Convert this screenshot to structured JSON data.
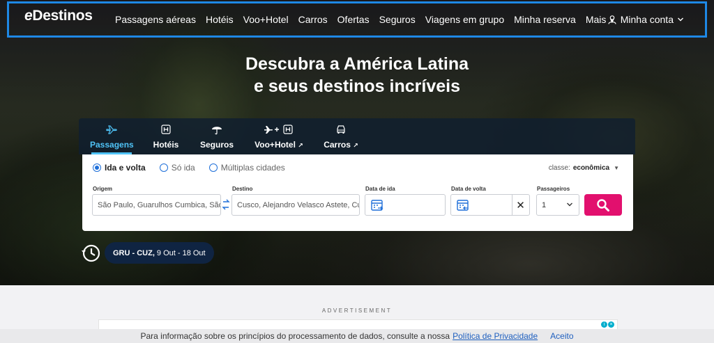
{
  "brand": {
    "logo_e": "e",
    "logo_rest": "Destinos"
  },
  "nav": {
    "items": [
      "Passagens aéreas",
      "Hotéis",
      "Voo+Hotel",
      "Carros",
      "Ofertas",
      "Seguros",
      "Viagens em grupo",
      "Minha reserva"
    ],
    "more_label": "Mais",
    "account_label": "Minha conta"
  },
  "hero": {
    "line1": "Descubra a América Latina",
    "line2": "e seus destinos incríveis"
  },
  "search_tabs": [
    {
      "label": "Passagens",
      "icon": "plane-icon",
      "active": true
    },
    {
      "label": "Hotéis",
      "icon": "hotel-icon",
      "active": false
    },
    {
      "label": "Seguros",
      "icon": "umbrella-icon",
      "active": false
    },
    {
      "label": "Voo+Hotel",
      "icon": "plane-plus-hotel-icon",
      "active": false,
      "external": true
    },
    {
      "label": "Carros",
      "icon": "car-icon",
      "active": false,
      "external": true
    }
  ],
  "trip_types": {
    "round_trip": "Ida e volta",
    "one_way": "Só ida",
    "multi_city": "Múltiplas cidades",
    "selected": "round_trip"
  },
  "classe": {
    "label": "classe:",
    "value": "econômica"
  },
  "fields": {
    "origin_label": "Origem",
    "origin_value": "São Paulo, Guarulhos Cumbica, São Paulo",
    "destination_label": "Destino",
    "destination_value": "Cusco, Alejandro Velasco Astete, Cusco",
    "depart_label": "Data de ida",
    "depart_value": "",
    "return_label": "Data de volta",
    "return_value": "",
    "passengers_label": "Passageiros",
    "passengers_value": "1"
  },
  "recent_search": {
    "route": "GRU - CUZ,",
    "dates": "9 Out - 18 Out"
  },
  "advertisement_label": "ADVERTISEMENT",
  "cookie_bar": {
    "text": "Para informação sobre os princípios do processamento de dados, consulte a nossa",
    "link": "Política de Privacidade",
    "accept": "Aceito"
  },
  "colors": {
    "accent": "#4fc3f7",
    "search_button": "#e2106e",
    "nav_highlight": "#1e88e5",
    "link": "#1e5fbf"
  }
}
